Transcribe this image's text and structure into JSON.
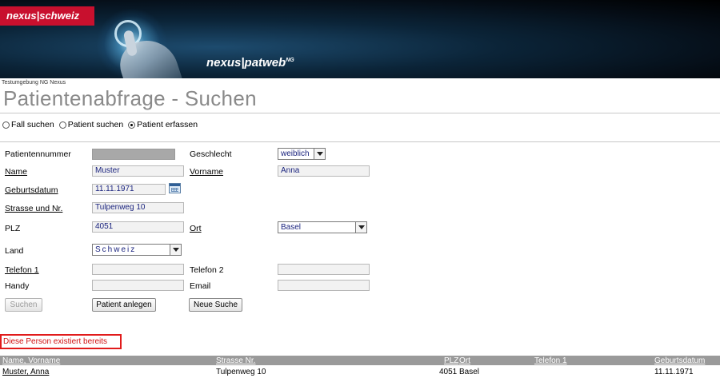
{
  "header": {
    "logo_text": "nexus|schweiz",
    "product_name": "nexus|patweb",
    "product_sup": "NG"
  },
  "environment_label": "Testumgebung NG Nexus",
  "page_title": "Patientenabfrage - Suchen",
  "search_mode": {
    "options": [
      "Fall suchen",
      "Patient suchen",
      "Patient erfassen"
    ],
    "selected": "Patient erfassen"
  },
  "form": {
    "patientennummer": {
      "label": "Patientennummer",
      "value": ""
    },
    "geschlecht": {
      "label": "Geschlecht",
      "value": "weiblich"
    },
    "name": {
      "label": "Name",
      "value": "Muster"
    },
    "vorname": {
      "label": "Vorname",
      "value": "Anna"
    },
    "geburtsdatum": {
      "label": "Geburtsdatum",
      "value": "11.11.1971"
    },
    "strasse": {
      "label": "Strasse und Nr.",
      "value": "Tulpenweg 10"
    },
    "plz": {
      "label": "PLZ",
      "value": "4051"
    },
    "ort": {
      "label": "Ort",
      "value": "Basel"
    },
    "land": {
      "label": "Land",
      "value": "Schweiz"
    },
    "telefon1": {
      "label": "Telefon 1",
      "value": ""
    },
    "telefon2": {
      "label": "Telefon 2",
      "value": ""
    },
    "handy": {
      "label": "Handy",
      "value": ""
    },
    "email": {
      "label": "Email",
      "value": ""
    }
  },
  "buttons": {
    "suchen": "Suchen",
    "patient_anlegen": "Patient anlegen",
    "neue_suche": "Neue Suche"
  },
  "error_message": "Diese Person existiert bereits",
  "results": {
    "columns": [
      "Name, Vorname",
      "Strasse Nr.",
      "PLZ",
      "Ort",
      "Telefon 1",
      "Geburtsdatum"
    ],
    "rows": [
      {
        "name": "Muster, Anna",
        "strasse": "Tulpenweg 10",
        "plz": "4051",
        "ort": "Basel",
        "telefon1": "",
        "geburtsdatum": "11.11.1971"
      }
    ]
  },
  "colors": {
    "brand_red": "#c8102e",
    "error_red": "#e11b1b",
    "table_header": "#9a9a9a",
    "title_grey": "#8a8a8a"
  }
}
